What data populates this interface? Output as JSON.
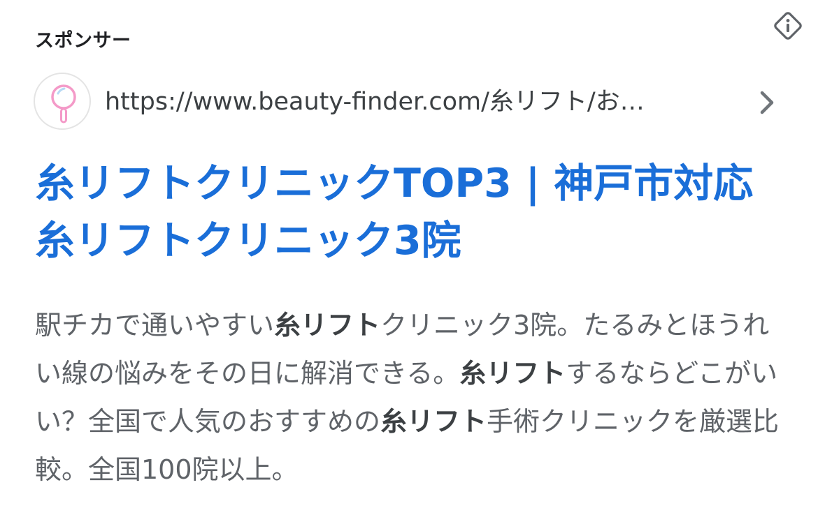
{
  "ad": {
    "sponsor_label": "スポンサー",
    "url": "https://www.beauty-finder.com/糸リフト/お…",
    "title": "糸リフトクリニックTOP3 | 神戸市対応糸リフトクリニック3院",
    "description": [
      {
        "text": "駅チカで通いやすい",
        "bold": false
      },
      {
        "text": "糸リフト",
        "bold": true
      },
      {
        "text": "クリニック3院。たるみとほうれい線の悩みをその日に解消できる。",
        "bold": false
      },
      {
        "text": "糸リフト",
        "bold": true
      },
      {
        "text": "するならどこがいい？全国で人気のおすすめの",
        "bold": false
      },
      {
        "text": "糸リフト",
        "bold": true
      },
      {
        "text": "手術クリニックを厳選比較。全国100院以上。",
        "bold": false
      }
    ],
    "icons": {
      "info": "info-icon",
      "favicon": "hand-mirror-icon",
      "chevron": "chevron-right-icon"
    },
    "colors": {
      "title": "#1a6ed8",
      "description": "#5f6368",
      "favicon_accent": "#f49ac8"
    }
  }
}
